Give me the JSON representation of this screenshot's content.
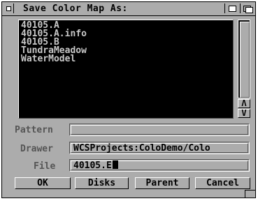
{
  "window": {
    "title": "Save Color Map As:"
  },
  "file_list": {
    "items": [
      "40105.A",
      "40105.A.info",
      "40105.B",
      "TundraMeadow",
      "WaterModel"
    ],
    "scroll_up": "Λ",
    "scroll_down": "V"
  },
  "fields": {
    "pattern": {
      "label": "Pattern",
      "value": ""
    },
    "drawer": {
      "label": "Drawer",
      "value": "WCSProjects:ColoDemo/Colo"
    },
    "file": {
      "label": "File",
      "value": "40105.E"
    }
  },
  "buttons": {
    "ok": "OK",
    "disks": "Disks",
    "parent": "Parent",
    "cancel": "Cancel"
  }
}
